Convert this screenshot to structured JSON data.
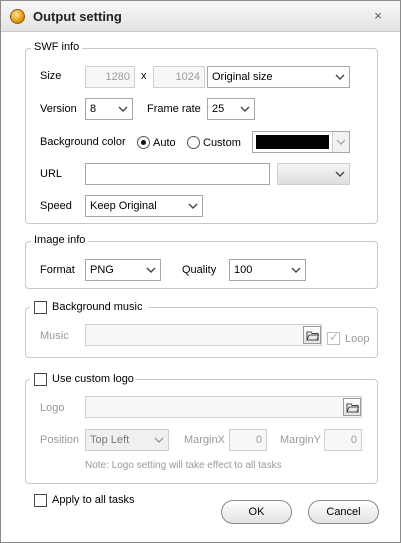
{
  "window": {
    "title": "Output setting",
    "close_glyph": "×"
  },
  "swf_info": {
    "legend": "SWF info",
    "size_label": "Size",
    "width": "1280",
    "x_sep": "x",
    "height": "1024",
    "size_preset": "Original size",
    "version_label": "Version",
    "version": "8",
    "frame_rate_label": "Frame rate",
    "frame_rate": "25",
    "bg_color_label": "Background color",
    "auto_label": "Auto",
    "custom_label": "Custom",
    "bg_mode": "Auto",
    "swatch_color": "#000000",
    "url_label": "URL",
    "url_value": "",
    "url_target": "",
    "speed_label": "Speed",
    "speed": "Keep Original"
  },
  "image_info": {
    "legend": "Image info",
    "format_label": "Format",
    "format": "PNG",
    "quality_label": "Quality",
    "quality": "100"
  },
  "background_music": {
    "label": "Background music",
    "checked": false,
    "music_label": "Music",
    "music_value": "",
    "loop_label": "Loop",
    "loop_checked": true
  },
  "custom_logo": {
    "label": "Use custom logo",
    "checked": false,
    "logo_label": "Logo",
    "logo_value": "",
    "position_label": "Position",
    "position": "Top Left",
    "marginx_label": "MarginX",
    "marginx": "0",
    "marginy_label": "MarginY",
    "marginy": "0",
    "note": "Note: Logo setting will take effect to all tasks"
  },
  "footer": {
    "apply_all_label": "Apply to all tasks",
    "apply_all_checked": false,
    "ok_label": "OK",
    "cancel_label": "Cancel"
  },
  "icons": {
    "app": "app-icon",
    "close": "close-icon",
    "chevron": "chevron-down-icon",
    "folder": "folder-icon"
  }
}
